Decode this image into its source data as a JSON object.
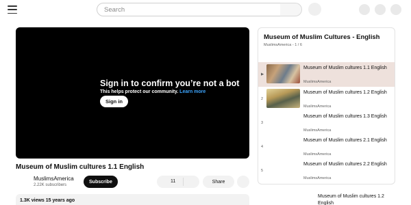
{
  "search": {
    "placeholder": "Search"
  },
  "player": {
    "overlay_title": "Sign in to confirm you’re not a bot",
    "overlay_subtitle": "This helps protect our community.",
    "learn_more": "Learn more",
    "sign_in": "Sign in"
  },
  "video": {
    "title": "Museum of Muslim cultures 1.1 English",
    "channel": "MuslimsAmerica",
    "subscribers": "2.22K subscribers",
    "subscribe_label": "Subscribe",
    "likes": "11",
    "share_label": "Share",
    "views_date": "1.3K views  15 years ago"
  },
  "playlist": {
    "title": "Museum of Muslim Cultures - English",
    "meta": "MuslimsAmerica - 1 / 6",
    "items": [
      {
        "index": "▶",
        "title": "Museum of Muslim cultures 1.1 English",
        "channel": "MuslimsAmerica"
      },
      {
        "index": "2",
        "title": "Museum of Muslim cultures 1.2 English",
        "channel": "MuslimsAmerica"
      },
      {
        "index": "3",
        "title": "Museum of Muslim cultures 1.3 English",
        "channel": "MuslimsAmerica"
      },
      {
        "index": "4",
        "title": "Museum of Muslim cultures 2.1 English",
        "channel": "MuslimsAmerica"
      },
      {
        "index": "5",
        "title": "Museum of Muslim cultures 2.2 English",
        "channel": "MuslimsAmerica"
      }
    ]
  },
  "up_next": {
    "title": "Museum of Muslim cultures 1.2 English"
  },
  "colors": {
    "active_row": "#eee1dc",
    "link": "#3ea6ff",
    "player_bg": "#000000"
  }
}
